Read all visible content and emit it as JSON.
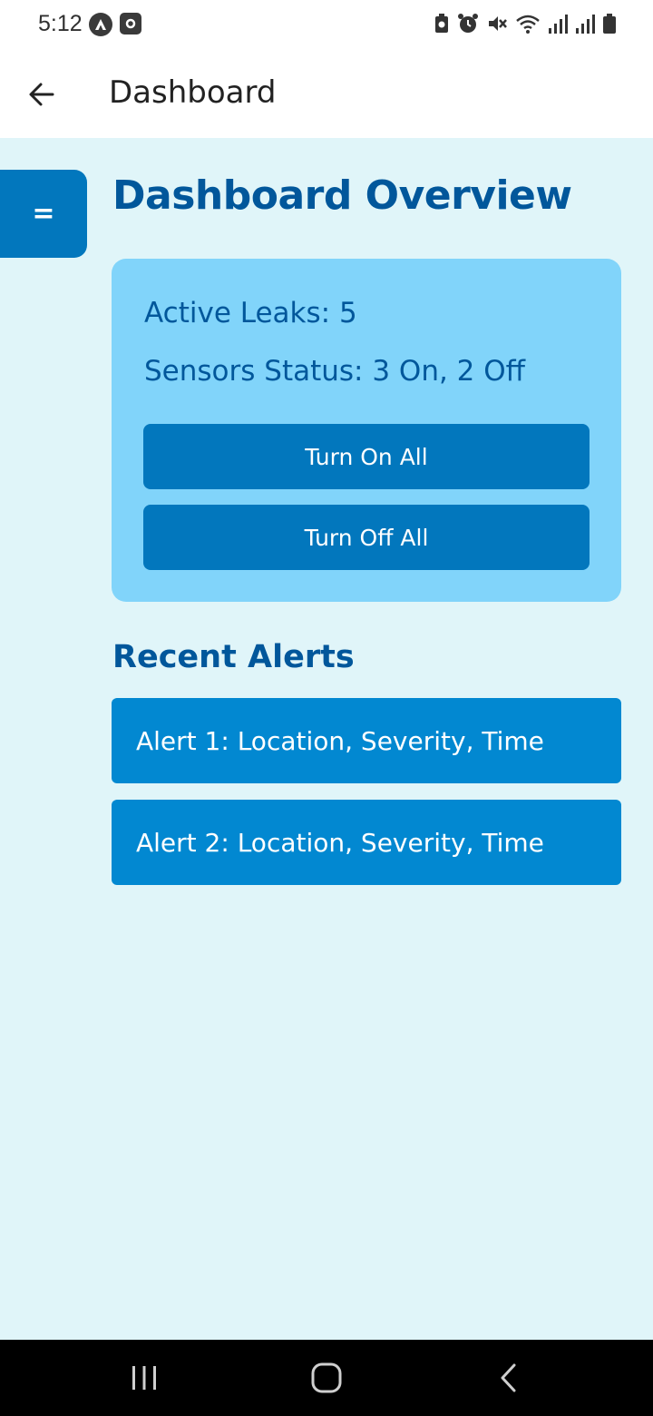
{
  "status_bar": {
    "time": "5:12",
    "left_icons": [
      "app-a-icon",
      "app-b-icon"
    ],
    "right_icons": [
      "battery-saver-icon",
      "alarm-icon",
      "mute-icon",
      "wifi-icon",
      "signal-icon",
      "signal-icon",
      "battery-icon"
    ]
  },
  "app_bar": {
    "back_icon": "arrow-left-icon",
    "title": "Dashboard"
  },
  "menu_tab": {
    "label": "="
  },
  "page": {
    "title": "Dashboard Overview"
  },
  "summary_card": {
    "active_leaks": "Active Leaks: 5",
    "sensors_status": "Sensors Status: 3 On, 2 Off",
    "turn_on_label": "Turn On All",
    "turn_off_label": "Turn Off All"
  },
  "alerts": {
    "title": "Recent Alerts",
    "items": [
      {
        "text": "Alert 1: Location, Severity, Time"
      },
      {
        "text": "Alert 2: Location, Severity, Time"
      }
    ]
  },
  "nav_bar": {
    "buttons": [
      "recents-icon",
      "home-icon",
      "back-icon"
    ]
  },
  "colors": {
    "primary": "#0277bd",
    "card": "#81d4fa",
    "alert": "#0288d1",
    "background": "#e0f5f9",
    "title_text": "#01579b"
  }
}
